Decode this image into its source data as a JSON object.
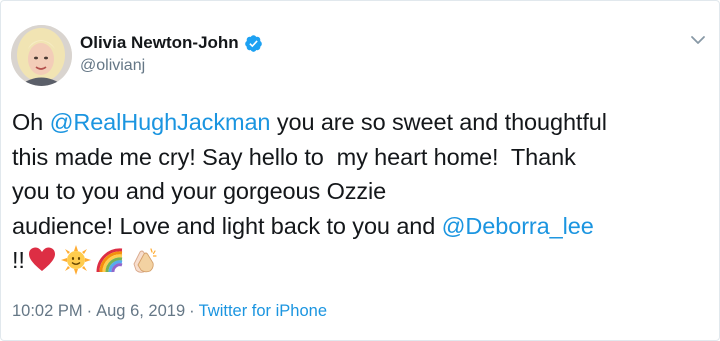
{
  "author": {
    "display_name": "Olivia Newton-John",
    "handle": "@olivianj",
    "verified": true
  },
  "tweet": {
    "line1_pre": "Oh ",
    "mention1": "@RealHughJackman",
    "line1_post": " you are so sweet and thoughtful",
    "line2": "this made me cry! Say hello to  my heart home!  Thank",
    "line3": "you to you and your gorgeous Ozzie",
    "line4_pre": "audience! Love and light back to you and ",
    "mention2": "@Deborra_lee",
    "line5_text": "!!",
    "emojis": [
      "red-heart",
      "sun-with-face",
      "rainbow",
      "clapping-hands"
    ]
  },
  "meta": {
    "time": "10:02 PM",
    "separator": "·",
    "date": "Aug 6, 2019",
    "source": "Twitter for iPhone"
  },
  "colors": {
    "link": "#1b95e0",
    "text": "#14171a",
    "secondary": "#657786",
    "verified": "#1da1f2",
    "border": "#e1e8ed"
  },
  "icons": {
    "verified": "verified-badge-icon",
    "more": "chevron-down-icon"
  }
}
